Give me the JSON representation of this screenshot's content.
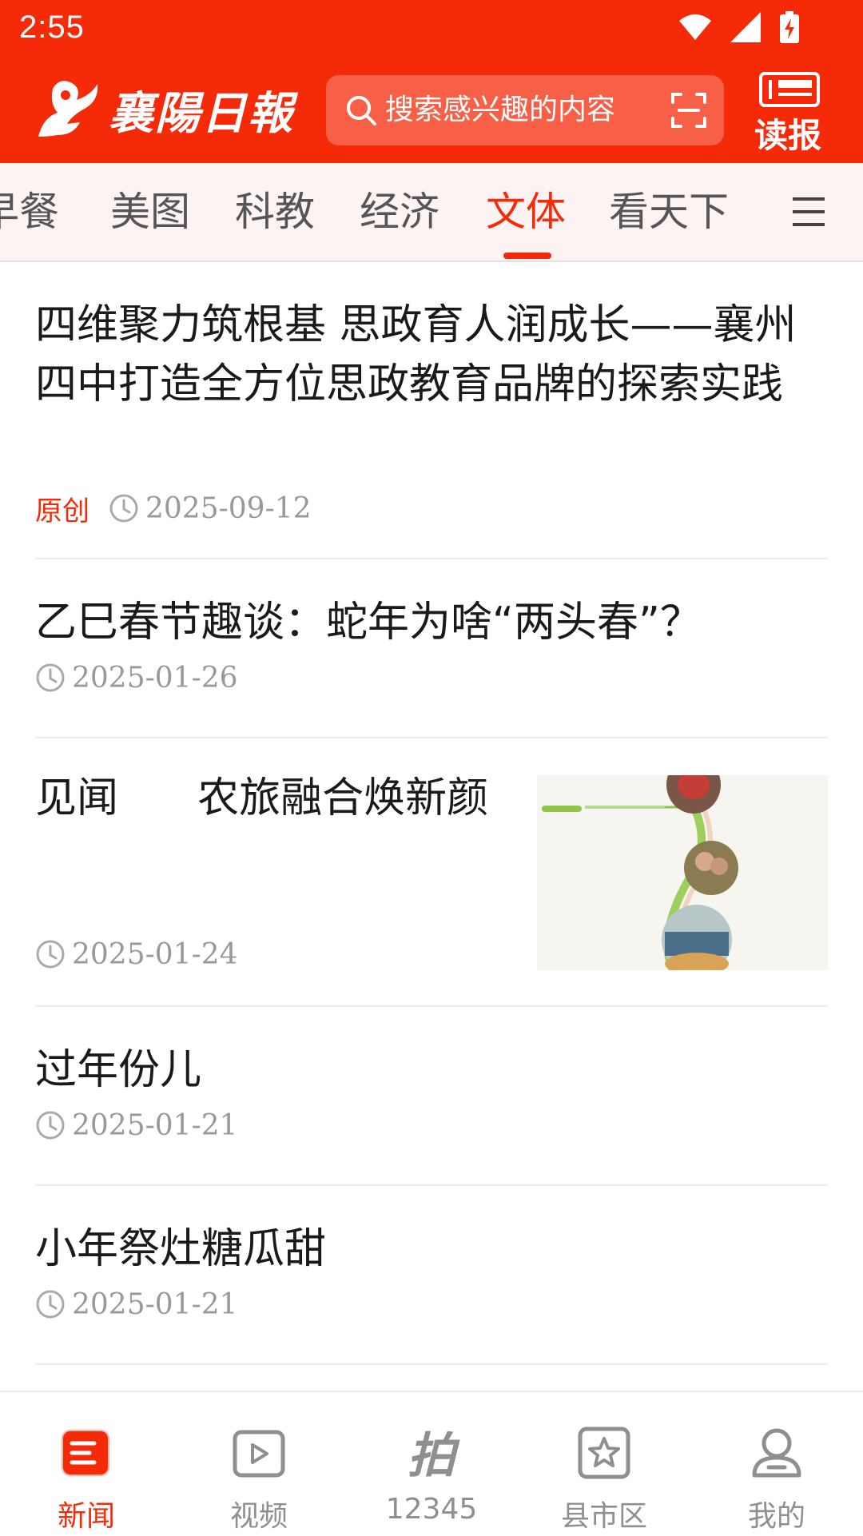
{
  "status_bar": {
    "time": "2:55"
  },
  "header": {
    "brand_name": "襄陽日報",
    "search_placeholder": "搜索感兴趣的内容",
    "read_paper_label": "读报"
  },
  "tabs": [
    {
      "label": "早餐"
    },
    {
      "label": "美图"
    },
    {
      "label": "科教"
    },
    {
      "label": "经济"
    },
    {
      "label": "文体",
      "active": true
    },
    {
      "label": "看天下"
    }
  ],
  "feed": [
    {
      "title": "四维聚力筑根基  思政育人润成长——襄州四中打造全方位思政教育品牌的探索实践",
      "tag": "原创",
      "date": "2025-09-12"
    },
    {
      "title": "乙巳春节趣谈：蛇年为啥“两头春”？",
      "date": "2025-01-26"
    },
    {
      "title": "见闻      农旅融合焕新颜",
      "date": "2025-01-24",
      "has_thumbnail": true
    },
    {
      "title": "过年份儿",
      "date": "2025-01-21"
    },
    {
      "title": "小年祭灶糖瓜甜",
      "date": "2025-01-21"
    }
  ],
  "bottom_nav": [
    {
      "label": "新闻",
      "icon": "news-icon",
      "active": true
    },
    {
      "label": "视频",
      "icon": "video-icon"
    },
    {
      "label": "12345",
      "icon": "pai-icon"
    },
    {
      "label": "县市区",
      "icon": "county-star-icon"
    },
    {
      "label": "我的",
      "icon": "profile-icon"
    }
  ],
  "colors": {
    "brand_red": "#f42a09",
    "tab_bar_bg": "#fdf3f2",
    "meta_gray": "#999999"
  }
}
